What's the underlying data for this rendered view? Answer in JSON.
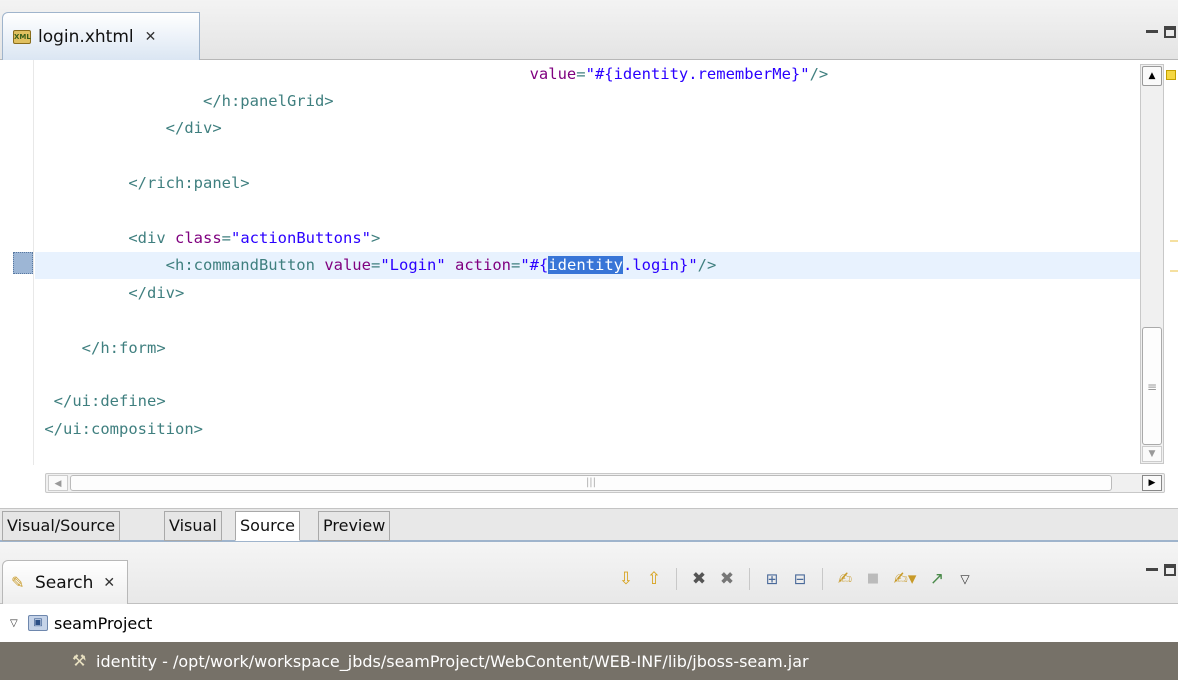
{
  "editor": {
    "tab_label": "login.xhtml",
    "tab_icon": "xhtml-file-icon",
    "code_lines": [
      {
        "indent": "                                                   ",
        "attr": "value",
        "value": "\"#{identity.rememberMe}\"",
        "tail": "/>"
      },
      {
        "text": "                </h:panelGrid>"
      },
      {
        "text": "            </div>"
      },
      {
        "text": ""
      },
      {
        "text": "        </rich:panel>"
      },
      {
        "text": ""
      },
      {
        "text": "        <div class=\"actionButtons\">"
      },
      {
        "text": "            <h:commandButton value=\"Login\" action=\"#{identity.login}\"/>"
      },
      {
        "text": "        </div>"
      },
      {
        "text": ""
      },
      {
        "text": "    </h:form>"
      },
      {
        "text": ""
      },
      {
        "text": " </ui:define>"
      },
      {
        "text": "</ui:composition>"
      }
    ],
    "line1_attr": "value",
    "line1_value": "\"#{identity.rememberMe}\"",
    "line1_tail": "/>",
    "line2": "</h:panelGrid>",
    "line3": "</div>",
    "line5": "</rich:panel>",
    "line7_open": "<div",
    "line7_attr": "class",
    "line7_value": "\"actionButtons\"",
    "line7_close": ">",
    "line8_open": "<h:commandButton",
    "line8_attr1": "value",
    "line8_value1": "\"Login\"",
    "line8_attr2": "action",
    "line8_value2_pre": "\"#{",
    "line8_selected": "identity",
    "line8_value2_post": ".login}\"",
    "line8_close": "/>",
    "line9": "</div>",
    "line11": "</h:form>",
    "line13": "</ui:define>",
    "line14": "</ui:composition>"
  },
  "page_tabs": [
    "Visual/Source",
    "Visual",
    "Source",
    "Preview"
  ],
  "active_page_tab": "Source",
  "search_view": {
    "tab_label": "Search",
    "toolbar_icons": [
      "next-match-icon",
      "previous-match-icon",
      "remove-match-icon",
      "remove-all-matches-icon",
      "expand-all-icon",
      "collapse-all-icon",
      "search-again-icon",
      "cancel-search-icon",
      "show-previous-searches-icon",
      "pin-search-view-icon",
      "view-menu-icon"
    ],
    "results": {
      "project": "seamProject",
      "match": "identity - /opt/work/workspace_jbds/seamProject/WebContent/WEB-INF/lib/jboss-seam.jar"
    }
  },
  "colors": {
    "tag": "#3f7f7f",
    "attribute": "#7f007f",
    "string": "#2a00ff",
    "selection": "#3875d7",
    "current_line": "#e8f2fe",
    "selected_result_row": "#767168"
  }
}
